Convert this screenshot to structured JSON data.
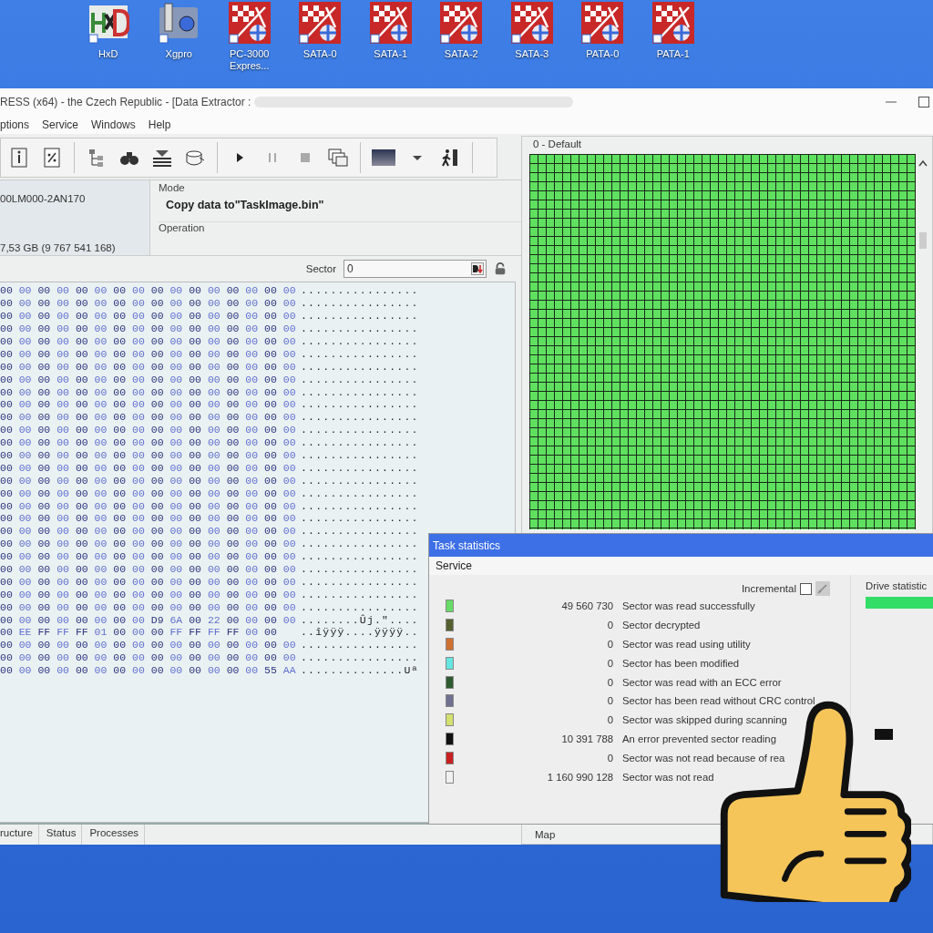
{
  "desktop_icons": [
    {
      "label": "HxD",
      "kind": "hxd"
    },
    {
      "label": "Xgpro",
      "kind": "xgpro"
    },
    {
      "label": "PC-3000 Expres...",
      "kind": "pc3000"
    },
    {
      "label": "SATA-0",
      "kind": "pc3000"
    },
    {
      "label": "SATA-1",
      "kind": "pc3000"
    },
    {
      "label": "SATA-2",
      "kind": "pc3000"
    },
    {
      "label": "SATA-3",
      "kind": "pc3000"
    },
    {
      "label": "PATA-0",
      "kind": "pc3000"
    },
    {
      "label": "PATA-1",
      "kind": "pc3000"
    }
  ],
  "window": {
    "title": "RESS (x64) - the Czech Republic - [Data Extractor :",
    "menu": [
      "ptions",
      "Service",
      "Windows",
      "Help"
    ]
  },
  "drive_info": {
    "model": "00LM000-2AN170",
    "capacity": "7,53 GB (9 767 541 168)"
  },
  "mode": {
    "label": "Mode",
    "value": "Copy data to\"TaskImage.bin\"",
    "operation_label": "Operation"
  },
  "sector": {
    "label": "Sector",
    "value": "0"
  },
  "hex_rows": [
    {
      "hex": "00 00 00 00 00 00 00 00 00 00 00 00 00 00 00 00",
      "ascii": "................"
    },
    {
      "hex": "00 00 00 00 00 00 00 00 00 00 00 00 00 00 00 00",
      "ascii": "................"
    },
    {
      "hex": "00 00 00 00 00 00 00 00 00 00 00 00 00 00 00 00",
      "ascii": "................"
    },
    {
      "hex": "00 00 00 00 00 00 00 00 00 00 00 00 00 00 00 00",
      "ascii": "................"
    },
    {
      "hex": "00 00 00 00 00 00 00 00 00 00 00 00 00 00 00 00",
      "ascii": "................"
    },
    {
      "hex": "00 00 00 00 00 00 00 00 00 00 00 00 00 00 00 00",
      "ascii": "................"
    },
    {
      "hex": "00 00 00 00 00 00 00 00 00 00 00 00 00 00 00 00",
      "ascii": "................"
    },
    {
      "hex": "00 00 00 00 00 00 00 00 00 00 00 00 00 00 00 00",
      "ascii": "................"
    },
    {
      "hex": "00 00 00 00 00 00 00 00 00 00 00 00 00 00 00 00",
      "ascii": "................"
    },
    {
      "hex": "00 00 00 00 00 00 00 00 00 00 00 00 00 00 00 00",
      "ascii": "................"
    },
    {
      "hex": "00 00 00 00 00 00 00 00 00 00 00 00 00 00 00 00",
      "ascii": "................"
    },
    {
      "hex": "00 00 00 00 00 00 00 00 00 00 00 00 00 00 00 00",
      "ascii": "................"
    },
    {
      "hex": "00 00 00 00 00 00 00 00 00 00 00 00 00 00 00 00",
      "ascii": "................"
    },
    {
      "hex": "00 00 00 00 00 00 00 00 00 00 00 00 00 00 00 00",
      "ascii": "................"
    },
    {
      "hex": "00 00 00 00 00 00 00 00 00 00 00 00 00 00 00 00",
      "ascii": "................"
    },
    {
      "hex": "00 00 00 00 00 00 00 00 00 00 00 00 00 00 00 00",
      "ascii": "................"
    },
    {
      "hex": "00 00 00 00 00 00 00 00 00 00 00 00 00 00 00 00",
      "ascii": "................"
    },
    {
      "hex": "00 00 00 00 00 00 00 00 00 00 00 00 00 00 00 00",
      "ascii": "................"
    },
    {
      "hex": "00 00 00 00 00 00 00 00 00 00 00 00 00 00 00 00",
      "ascii": "................"
    },
    {
      "hex": "00 00 00 00 00 00 00 00 00 00 00 00 00 00 00 00",
      "ascii": "................"
    },
    {
      "hex": "00 00 00 00 00 00 00 00 00 00 00 00 00 00 00 00",
      "ascii": "................"
    },
    {
      "hex": "00 00 00 00 00 00 00 00 00 00 00 00 00 00 00 00",
      "ascii": "................"
    },
    {
      "hex": "00 00 00 00 00 00 00 00 00 00 00 00 00 00 00 00",
      "ascii": "................"
    },
    {
      "hex": "00 00 00 00 00 00 00 00 00 00 00 00 00 00 00 00",
      "ascii": "................"
    },
    {
      "hex": "00 00 00 00 00 00 00 00 00 00 00 00 00 00 00 00",
      "ascii": "................"
    },
    {
      "hex": "00 00 00 00 00 00 00 00 00 00 00 00 00 00 00 00",
      "ascii": "................"
    },
    {
      "hex": "00 00 00 00 00 00 00 00 D9 6A 00 22 00 00 00 00",
      "ascii": "........Ûj.\"...."
    },
    {
      "hex": "00 EE FF FF FF 01 00 00 00 FF FF FF FF 00 00",
      "ascii": "..îÿÿÿ....ÿÿÿÿ.."
    },
    {
      "hex": "00 00 00 00 00 00 00 00 00 00 00 00 00 00 00 00",
      "ascii": "................"
    },
    {
      "hex": "00 00 00 00 00 00 00 00 00 00 00 00 00 00 00 00",
      "ascii": "................"
    },
    {
      "hex": "00 00 00 00 00 00 00 00 00 00 00 00 00 00 55 AA",
      "ascii": "..............Uª"
    }
  ],
  "bottom_tabs": [
    "ructure",
    "Status",
    "Processes"
  ],
  "map": {
    "title": "0 - Default",
    "tab": "Map"
  },
  "task_statistics": {
    "title": "Task statistics",
    "menu": [
      "Service"
    ],
    "incremental": {
      "label": "Incremental",
      "checked": false
    },
    "drive_statistic": "Drive statistic",
    "rows": [
      {
        "color": "#66dd66",
        "count": "49 560 730",
        "label": "Sector was read successfully"
      },
      {
        "color": "#556030",
        "count": "0",
        "label": "Sector decrypted"
      },
      {
        "color": "#d07030",
        "count": "0",
        "label": "Sector was read using utility"
      },
      {
        "color": "#66e6e0",
        "count": "0",
        "label": "Sector has been modified"
      },
      {
        "color": "#2f5a30",
        "count": "0",
        "label": "Sector was read with an ECC error"
      },
      {
        "color": "#707090",
        "count": "0",
        "label": "Sector has been read without CRC control"
      },
      {
        "color": "#d4e070",
        "count": "0",
        "label": "Sector was skipped during scanning"
      },
      {
        "color": "#111111",
        "count": "10 391 788",
        "label": "An error prevented sector reading"
      },
      {
        "color": "#c82020",
        "count": "0",
        "label": "Sector was not read because of rea"
      },
      {
        "color": "#f0f0f0",
        "count": "1 160 990 128",
        "label": "Sector was not read"
      }
    ]
  }
}
